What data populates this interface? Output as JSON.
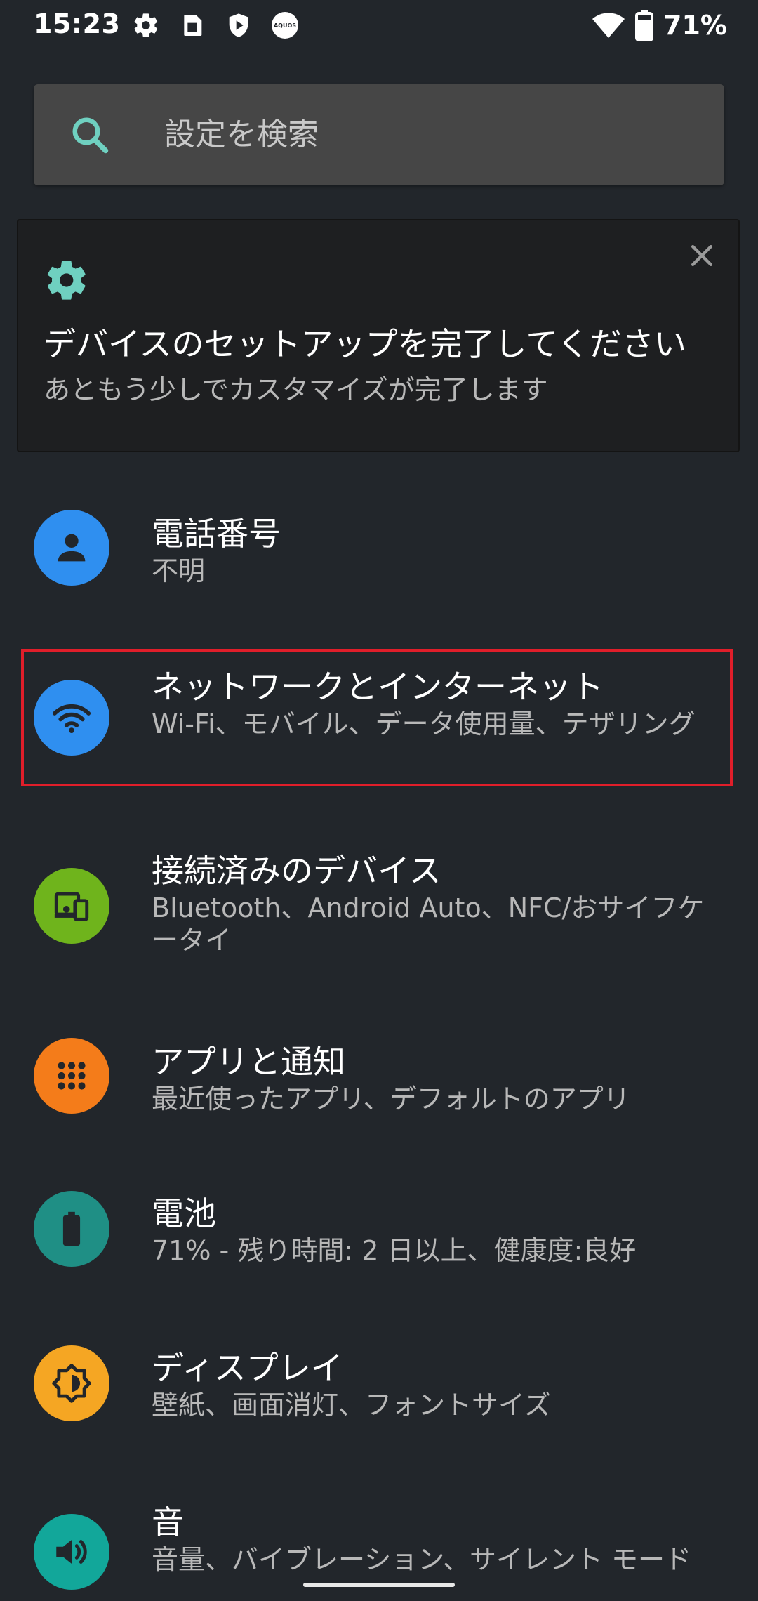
{
  "status_bar": {
    "time": "15:23",
    "left_icons": [
      "gear-icon",
      "sim-icon",
      "shield-icon",
      "aquos-icon"
    ],
    "aquos_label": "AQUOS",
    "right_icons": [
      "wifi-icon",
      "battery-icon"
    ],
    "battery_percent": "71%"
  },
  "search": {
    "placeholder": "設定を検索"
  },
  "setup_card": {
    "title": "デバイスのセットアップを完了してください",
    "subtitle": "あともう少しでカスタマイズが完了します"
  },
  "settings": [
    {
      "title": "電話番号",
      "subtitle": "不明",
      "icon": "person-icon",
      "color": "#2f8ff0"
    },
    {
      "title": "ネットワークとインターネット",
      "subtitle": "Wi-Fi、モバイル、データ使用量、テザリング",
      "icon": "wifi-icon",
      "color": "#2f8ff0"
    },
    {
      "title": "接続済みのデバイス",
      "subtitle": "Bluetooth、Android Auto、NFC/おサイフケータイ",
      "icon": "devices-icon",
      "color": "#6fb41c"
    },
    {
      "title": "アプリと通知",
      "subtitle": "最近使ったアプリ、デフォルトのアプリ",
      "icon": "apps-grid-icon",
      "color": "#f47c1a"
    },
    {
      "title": "電池",
      "subtitle": "71% - 残り時間: 2 日以上、健康度:良好",
      "icon": "battery-icon",
      "color": "#1f8f85"
    },
    {
      "title": "ディスプレイ",
      "subtitle": "壁紙、画面消灯、フォントサイズ",
      "icon": "brightness-icon",
      "color": "#f5a623"
    },
    {
      "title": "音",
      "subtitle": "音量、バイブレーション、サイレント モード",
      "icon": "volume-icon",
      "color": "#12a79a"
    }
  ],
  "colors": {
    "background": "#22262b",
    "accent_teal": "#6fd0c0",
    "highlight_red": "#e01e2a"
  }
}
